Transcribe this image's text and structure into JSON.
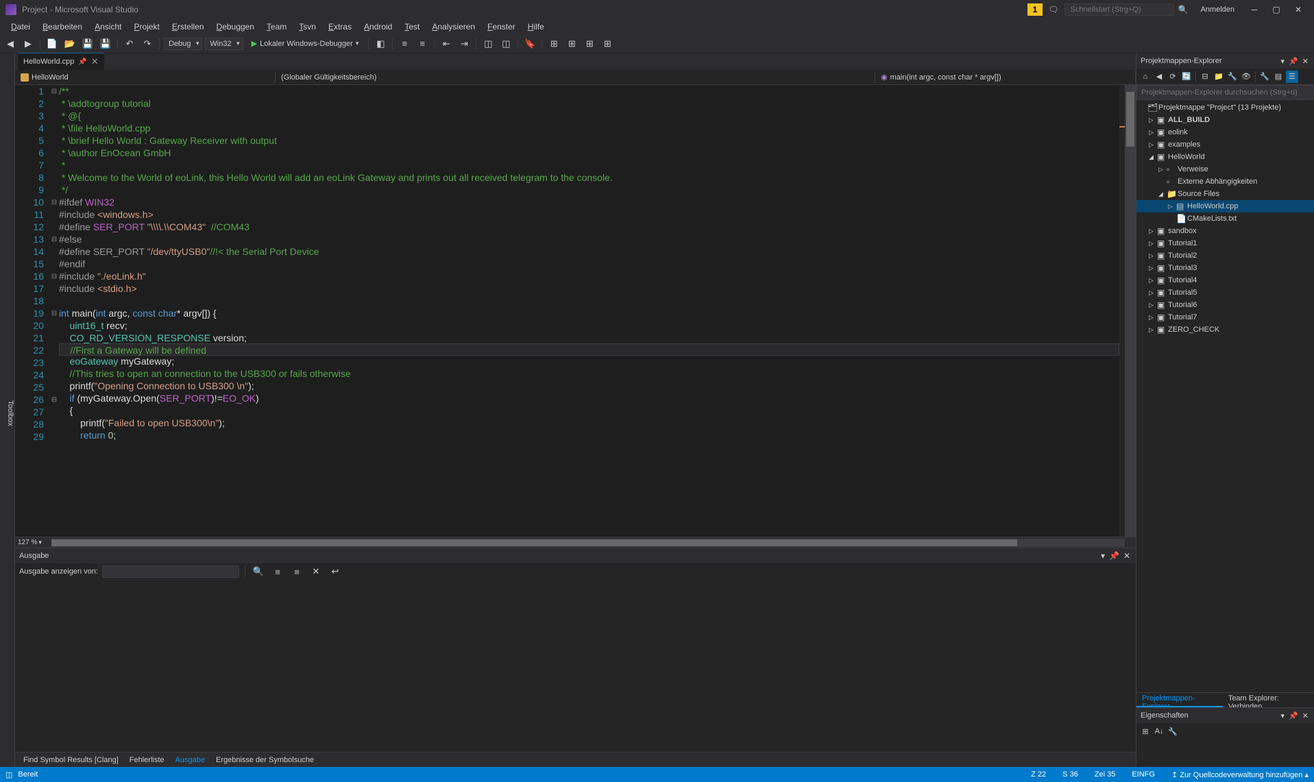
{
  "title": "Project - Microsoft Visual Studio",
  "quick_launch_placeholder": "Schnellstart (Strg+Q)",
  "login": "Anmelden",
  "notif": "1",
  "menus": [
    "Datei",
    "Bearbeiten",
    "Ansicht",
    "Projekt",
    "Erstellen",
    "Debuggen",
    "Team",
    "Tsvn",
    "Extras",
    "Android",
    "Test",
    "Analysieren",
    "Fenster",
    "Hilfe"
  ],
  "toolbar": {
    "config": "Debug",
    "platform": "Win32",
    "debug_target": "Lokaler Windows-Debugger"
  },
  "tab": {
    "name": "HelloWorld.cpp"
  },
  "navbar": {
    "project": "HelloWorld",
    "scope": "(Globaler Gültigkeitsbereich)",
    "func": "main(int argc, const char * argv[])"
  },
  "code": {
    "lines": [
      {
        "n": 1,
        "fold": "⊟",
        "segs": [
          {
            "t": "/**",
            "c": "c-comment"
          }
        ]
      },
      {
        "n": 2,
        "segs": [
          {
            "t": " * \\addtogroup tutorial",
            "c": "c-comment"
          }
        ]
      },
      {
        "n": 3,
        "segs": [
          {
            "t": " * @{",
            "c": "c-comment"
          }
        ]
      },
      {
        "n": 4,
        "segs": [
          {
            "t": " * \\file HelloWorld.cpp",
            "c": "c-comment"
          }
        ]
      },
      {
        "n": 5,
        "segs": [
          {
            "t": " * \\brief Hello World : Gateway Receiver with output",
            "c": "c-comment"
          }
        ]
      },
      {
        "n": 6,
        "segs": [
          {
            "t": " * \\author EnOcean GmbH",
            "c": "c-comment"
          }
        ]
      },
      {
        "n": 7,
        "segs": [
          {
            "t": " *",
            "c": "c-comment"
          }
        ]
      },
      {
        "n": 8,
        "segs": [
          {
            "t": " * Welcome to the World of eoLink, this Hello World will add an eoLink Gateway and prints out all received telegram to the console.",
            "c": "c-comment"
          }
        ]
      },
      {
        "n": 9,
        "segs": [
          {
            "t": " */",
            "c": "c-comment"
          }
        ]
      },
      {
        "n": 10,
        "fold": "⊟",
        "segs": [
          {
            "t": "#ifdef ",
            "c": "c-pp"
          },
          {
            "t": "WIN32",
            "c": "c-macro-name"
          }
        ]
      },
      {
        "n": 11,
        "segs": [
          {
            "t": "#include ",
            "c": "c-pp"
          },
          {
            "t": "<windows.h>",
            "c": "c-string"
          }
        ]
      },
      {
        "n": 12,
        "segs": [
          {
            "t": "#define ",
            "c": "c-pp"
          },
          {
            "t": "SER_PORT ",
            "c": "c-macro-name"
          },
          {
            "t": "\"\\\\\\\\.\\\\COM43\"",
            "c": "c-string"
          },
          {
            "t": "  //COM43",
            "c": "c-comment"
          }
        ]
      },
      {
        "n": 13,
        "fold": "⊟",
        "segs": [
          {
            "t": "#else",
            "c": "c-pp"
          }
        ]
      },
      {
        "n": 14,
        "segs": [
          {
            "t": "#define ",
            "c": "c-macro"
          },
          {
            "t": "SER_PORT ",
            "c": "c-macro"
          },
          {
            "t": "\"/dev/ttyUSB0\"",
            "c": "c-string"
          },
          {
            "t": "//!< the Serial Port Device",
            "c": "c-comment"
          }
        ]
      },
      {
        "n": 15,
        "segs": [
          {
            "t": "#endif",
            "c": "c-pp"
          }
        ]
      },
      {
        "n": 16,
        "fold": "⊟",
        "segs": [
          {
            "t": "#include ",
            "c": "c-pp"
          },
          {
            "t": "\"./eoLink.h\"",
            "c": "c-string"
          }
        ]
      },
      {
        "n": 17,
        "segs": [
          {
            "t": "#include ",
            "c": "c-pp"
          },
          {
            "t": "<stdio.h>",
            "c": "c-string"
          }
        ]
      },
      {
        "n": 18,
        "segs": [
          {
            "t": "",
            "c": ""
          }
        ]
      },
      {
        "n": 19,
        "fold": "⊟",
        "segs": [
          {
            "t": "int ",
            "c": "c-keyword"
          },
          {
            "t": "main(",
            "c": "c-ident"
          },
          {
            "t": "int ",
            "c": "c-keyword"
          },
          {
            "t": "argc, ",
            "c": "c-ident"
          },
          {
            "t": "const char",
            "c": "c-keyword"
          },
          {
            "t": "* argv[]) {",
            "c": "c-ident"
          }
        ]
      },
      {
        "n": 20,
        "segs": [
          {
            "t": "    uint16_t ",
            "c": "c-type"
          },
          {
            "t": "recv;",
            "c": "c-ident"
          }
        ]
      },
      {
        "n": 21,
        "segs": [
          {
            "t": "    CO_RD_VERSION_RESPONSE ",
            "c": "c-type"
          },
          {
            "t": "version;",
            "c": "c-ident"
          }
        ]
      },
      {
        "n": 22,
        "hl": true,
        "segs": [
          {
            "t": "    //First a Gateway will be defined",
            "c": "c-comment"
          }
        ]
      },
      {
        "n": 23,
        "segs": [
          {
            "t": "    eoGateway ",
            "c": "c-type"
          },
          {
            "t": "myGateway;",
            "c": "c-ident"
          }
        ]
      },
      {
        "n": 24,
        "segs": [
          {
            "t": "    //This tries to open an connection to the USB300 or fails otherwise",
            "c": "c-comment"
          }
        ]
      },
      {
        "n": 25,
        "segs": [
          {
            "t": "    printf(",
            "c": "c-ident"
          },
          {
            "t": "\"Opening Connection to USB300 \\n\"",
            "c": "c-string"
          },
          {
            "t": ");",
            "c": "c-ident"
          }
        ]
      },
      {
        "n": 26,
        "fold": "⊟",
        "segs": [
          {
            "t": "    if ",
            "c": "c-keyword"
          },
          {
            "t": "(myGateway.Open(",
            "c": "c-ident"
          },
          {
            "t": "SER_PORT",
            "c": "c-macro-name"
          },
          {
            "t": ")!=",
            "c": "c-ident"
          },
          {
            "t": "EO_OK",
            "c": "c-macro-name"
          },
          {
            "t": ")",
            "c": "c-ident"
          }
        ]
      },
      {
        "n": 27,
        "segs": [
          {
            "t": "    {",
            "c": "c-ident"
          }
        ]
      },
      {
        "n": 28,
        "segs": [
          {
            "t": "        printf(",
            "c": "c-ident"
          },
          {
            "t": "\"Failed to open USB300\\n\"",
            "c": "c-string"
          },
          {
            "t": ");",
            "c": "c-ident"
          }
        ]
      },
      {
        "n": 29,
        "segs": [
          {
            "t": "        return ",
            "c": "c-keyword"
          },
          {
            "t": "0",
            "c": "c-num"
          },
          {
            "t": ";",
            "c": "c-ident"
          }
        ]
      }
    ]
  },
  "zoom": "127 %",
  "output": {
    "title": "Ausgabe",
    "show_from": "Ausgabe anzeigen von:"
  },
  "bottom_tabs": [
    "Find Symbol Results [Clang]",
    "Fehlerliste",
    "Ausgabe",
    "Ergebnisse der Symbolsuche"
  ],
  "bottom_active": 2,
  "solution_explorer": {
    "title": "Projektmappen-Explorer",
    "search_placeholder": "Projektmappen-Explorer durchsuchen (Strg+ü)",
    "root": "Projektmappe \"Project\" (13 Projekte)",
    "nodes": [
      {
        "indent": 1,
        "arrow": "▷",
        "icon": "proj",
        "label": "ALL_BUILD",
        "bold": true
      },
      {
        "indent": 1,
        "arrow": "▷",
        "icon": "proj",
        "label": "eolink"
      },
      {
        "indent": 1,
        "arrow": "▷",
        "icon": "proj",
        "label": "examples"
      },
      {
        "indent": 1,
        "arrow": "◢",
        "icon": "proj",
        "label": "HelloWorld"
      },
      {
        "indent": 2,
        "arrow": "▷",
        "icon": "ref",
        "label": "Verweise"
      },
      {
        "indent": 2,
        "arrow": "",
        "icon": "ref",
        "label": "Externe Abhängigkeiten"
      },
      {
        "indent": 2,
        "arrow": "◢",
        "icon": "folder",
        "label": "Source Files"
      },
      {
        "indent": 3,
        "arrow": "▷",
        "icon": "cpp",
        "label": "HelloWorld.cpp",
        "selected": true
      },
      {
        "indent": 3,
        "arrow": "",
        "icon": "txt",
        "label": "CMakeLists.txt"
      },
      {
        "indent": 1,
        "arrow": "▷",
        "icon": "proj",
        "label": "sandbox"
      },
      {
        "indent": 1,
        "arrow": "▷",
        "icon": "proj",
        "label": "Tutorial1"
      },
      {
        "indent": 1,
        "arrow": "▷",
        "icon": "proj",
        "label": "Tutorial2"
      },
      {
        "indent": 1,
        "arrow": "▷",
        "icon": "proj",
        "label": "Tutorial3"
      },
      {
        "indent": 1,
        "arrow": "▷",
        "icon": "proj",
        "label": "Tutorial4"
      },
      {
        "indent": 1,
        "arrow": "▷",
        "icon": "proj",
        "label": "Tutorial5"
      },
      {
        "indent": 1,
        "arrow": "▷",
        "icon": "proj",
        "label": "Tutorial6"
      },
      {
        "indent": 1,
        "arrow": "▷",
        "icon": "proj",
        "label": "Tutorial7"
      },
      {
        "indent": 1,
        "arrow": "▷",
        "icon": "proj",
        "label": "ZERO_CHECK"
      }
    ],
    "tabs": [
      "Projektmappen-Explorer",
      "Team Explorer: Verbinden"
    ]
  },
  "properties": {
    "title": "Eigenschaften"
  },
  "status": {
    "ready": "Bereit",
    "line": "Z 22",
    "col": "S 36",
    "char": "Zei 35",
    "ins": "EINFG",
    "src_ctrl": "Zur Quellcodeverwaltung hinzufügen"
  },
  "toolbox": "Toolbox"
}
